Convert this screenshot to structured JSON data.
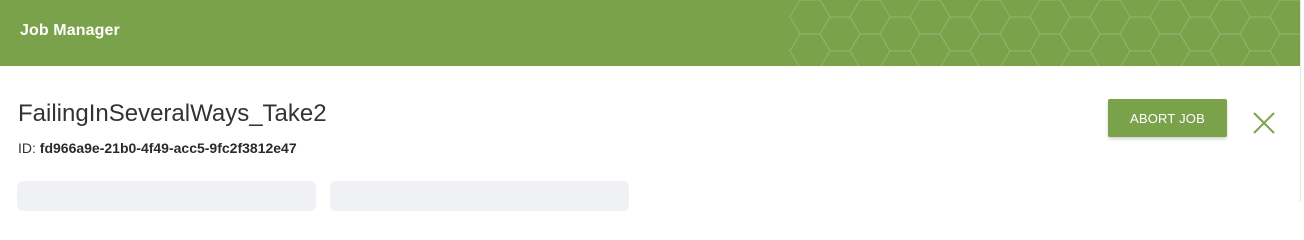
{
  "header": {
    "title": "Job Manager",
    "background_color": "#7aa24b"
  },
  "job": {
    "name": "FailingInSeveralWays_Take2",
    "id_label": "ID:",
    "id_value": "fd966a9e-21b0-4f49-acc5-9fc2f3812e47"
  },
  "actions": {
    "abort_label": "ABORT JOB",
    "close_icon": "close-icon",
    "accent_color": "#7aa24b"
  },
  "tabs": [
    {
      "label": ""
    },
    {
      "label": ""
    }
  ]
}
